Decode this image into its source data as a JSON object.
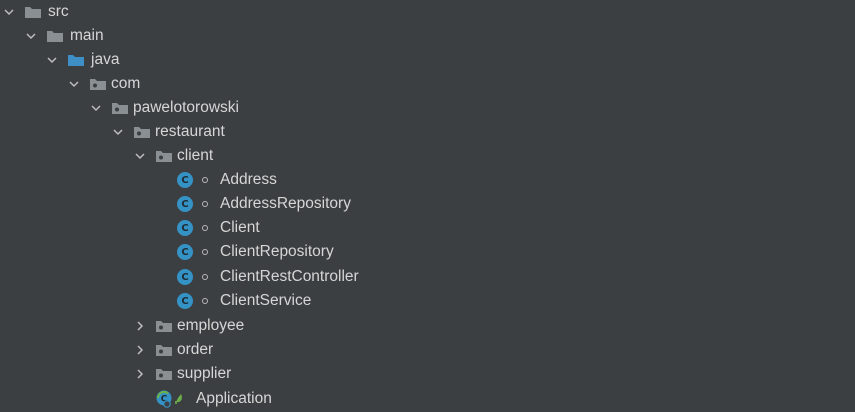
{
  "tree": {
    "src": "src",
    "main": "main",
    "java": "java",
    "com": "com",
    "pawelotorowski": "pawelotorowski",
    "restaurant": "restaurant",
    "client": "client",
    "client_classes": [
      "Address",
      "AddressRepository",
      "Client",
      "ClientRepository",
      "ClientRestController",
      "ClientService"
    ],
    "employee": "employee",
    "order": "order",
    "supplier": "supplier",
    "application": "Application"
  },
  "icons": {
    "expanded": "chevron-down-icon",
    "collapsed": "chevron-right-icon",
    "folder": "folder-icon",
    "source_root": "source-folder-icon",
    "package": "package-icon",
    "class": "class-icon",
    "spring_app": "spring-boot-class-icon"
  },
  "colors": {
    "background": "#3c3f41",
    "text": "#d6d6d6",
    "folder": "#8a8f93",
    "source_folder": "#3d8fc6",
    "class_badge": "#3592c4",
    "spring": "#6cb04a"
  }
}
